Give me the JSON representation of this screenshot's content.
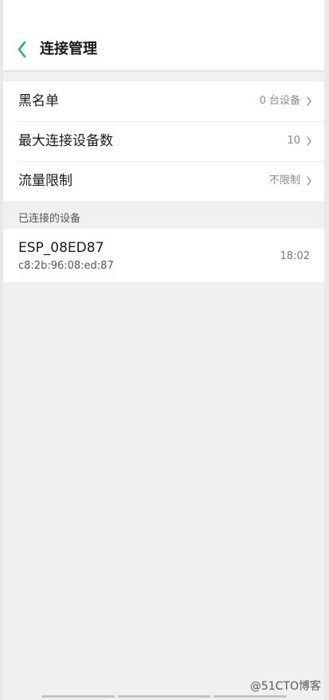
{
  "header": {
    "title": "连接管理",
    "back_icon": "chevron-left-icon",
    "accent_color": "#1fb07a"
  },
  "settings": [
    {
      "label": "黑名单",
      "value": "0 台设备"
    },
    {
      "label": "最大连接设备数",
      "value": "10"
    },
    {
      "label": "流量限制",
      "value": "不限制"
    }
  ],
  "connected": {
    "section_title": "已连接的设备",
    "devices": [
      {
        "name": "ESP_08ED87",
        "mac": "c8:2b:96:08:ed:87",
        "time": "18:02"
      }
    ]
  },
  "watermark": "@51CTO博客"
}
